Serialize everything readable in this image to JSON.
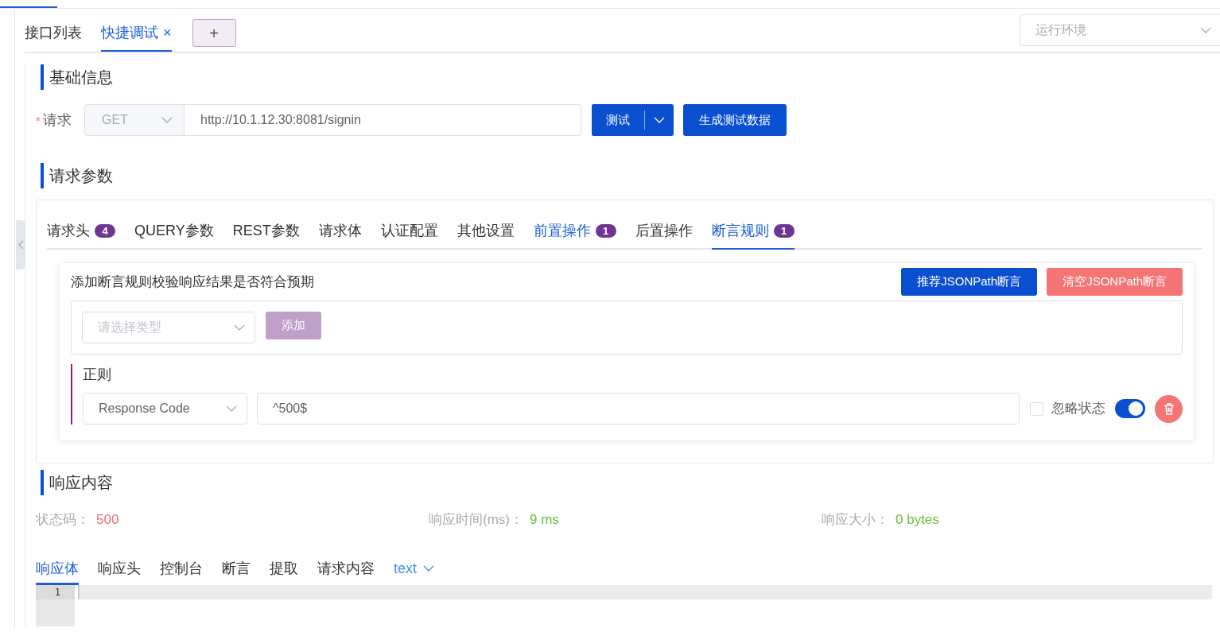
{
  "top_tabs": [
    {
      "label": "接口列表",
      "selected": false,
      "closable": false
    },
    {
      "label": "快捷调试",
      "selected": true,
      "closable": true,
      "close_icon": "×"
    }
  ],
  "add_tab": "+",
  "environment_select": {
    "placeholder": "运行环境"
  },
  "basic_info": {
    "title": "基础信息",
    "required_mark": "*",
    "request_label": "请求",
    "method": "GET",
    "url": "http://10.1.12.30:8081/signin",
    "test_button": "测试",
    "generate_button": "生成测试数据"
  },
  "params": {
    "title": "请求参数",
    "tabs": [
      {
        "label": "请求头",
        "badge": "4",
        "selected": false,
        "highlighted": false
      },
      {
        "label": "QUERY参数",
        "selected": false,
        "highlighted": false
      },
      {
        "label": "REST参数",
        "selected": false,
        "highlighted": false
      },
      {
        "label": "请求体",
        "selected": false,
        "highlighted": false
      },
      {
        "label": "认证配置",
        "selected": false,
        "highlighted": false
      },
      {
        "label": "其他设置",
        "selected": false,
        "highlighted": false
      },
      {
        "label": "前置操作",
        "badge": "1",
        "selected": false,
        "highlighted": true
      },
      {
        "label": "后置操作",
        "selected": false,
        "highlighted": false
      },
      {
        "label": "断言规则",
        "badge": "1",
        "selected": true,
        "highlighted": true
      }
    ]
  },
  "assertion": {
    "intro": "添加断言规则校验响应结果是否符合预期",
    "recommend_button": "推荐JSONPath断言",
    "clear_button": "清空JSONPath断言",
    "type_select": {
      "placeholder": "请选择类型"
    },
    "add_button": "添加",
    "add_disabled": true,
    "rules": [
      {
        "title": "正则",
        "source": "Response Code",
        "pattern": "^500$",
        "ignore_status_label": "忽略状态",
        "ignore_status_checked": false,
        "on": true
      }
    ]
  },
  "response": {
    "title": "响应内容",
    "stats": [
      {
        "label": "状态码：",
        "value": "500",
        "kind": "error"
      },
      {
        "label": "响应时间(ms)：",
        "value": "9 ms",
        "kind": "ok"
      },
      {
        "label": "响应大小：",
        "value": "0 bytes",
        "kind": "ok"
      }
    ],
    "tabs": [
      {
        "label": "响应体",
        "selected": true,
        "kind": "tab"
      },
      {
        "label": "响应头",
        "selected": false,
        "kind": "tab"
      },
      {
        "label": "控制台",
        "selected": false,
        "kind": "tab"
      },
      {
        "label": "断言",
        "selected": false,
        "kind": "tab"
      },
      {
        "label": "提取",
        "selected": false,
        "kind": "tab"
      },
      {
        "label": "请求内容",
        "selected": false,
        "kind": "tab"
      },
      {
        "label": "text",
        "selected": false,
        "kind": "dropdown"
      }
    ],
    "editor": {
      "line_numbers": [
        "1"
      ]
    }
  }
}
